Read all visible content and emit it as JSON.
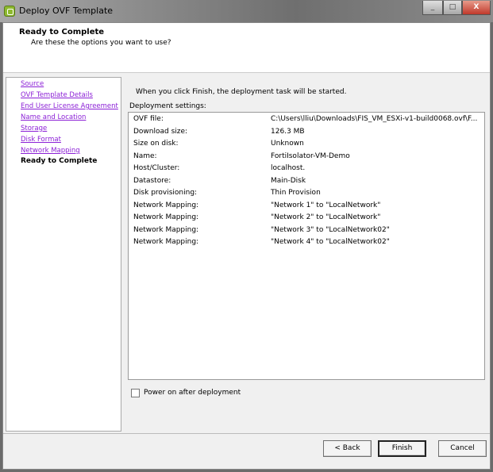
{
  "window": {
    "title": "Deploy OVF Template",
    "minimize": "_",
    "maximize": "□",
    "close": "X"
  },
  "header": {
    "title": "Ready to Complete",
    "subtitle": "Are these the options you want to use?"
  },
  "nav": {
    "items": [
      "Source",
      "OVF Template Details",
      "End User License Agreement",
      "Name and Location",
      "Storage",
      "Disk Format",
      "Network Mapping"
    ],
    "current": "Ready to Complete"
  },
  "main": {
    "intro": "When you click Finish, the deployment task will be started.",
    "settings_label": "Deployment settings:",
    "settings": [
      {
        "key": "OVF file:",
        "value": "C:\\Users\\lliu\\Downloads\\FIS_VM_ESXi-v1-build0068.ovf\\F..."
      },
      {
        "key": "Download size:",
        "value": "126.3 MB"
      },
      {
        "key": "Size on disk:",
        "value": "Unknown"
      },
      {
        "key": "Name:",
        "value": "FortiIsolator-VM-Demo"
      },
      {
        "key": "Host/Cluster:",
        "value": "localhost."
      },
      {
        "key": "Datastore:",
        "value": "Main-Disk"
      },
      {
        "key": "Disk provisioning:",
        "value": "Thin Provision"
      },
      {
        "key": "Network Mapping:",
        "value": "\"Network 1\" to \"LocalNetwork\""
      },
      {
        "key": "Network Mapping:",
        "value": "\"Network 2\" to \"LocalNetwork\""
      },
      {
        "key": "Network Mapping:",
        "value": "\"Network 3\" to \"LocalNetwork02\""
      },
      {
        "key": "Network Mapping:",
        "value": "\"Network 4\" to \"LocalNetwork02\""
      }
    ],
    "power_on_label": "Power on after deployment",
    "power_on": false
  },
  "buttons": {
    "back": "< Back",
    "finish": "Finish",
    "cancel": "Cancel"
  }
}
